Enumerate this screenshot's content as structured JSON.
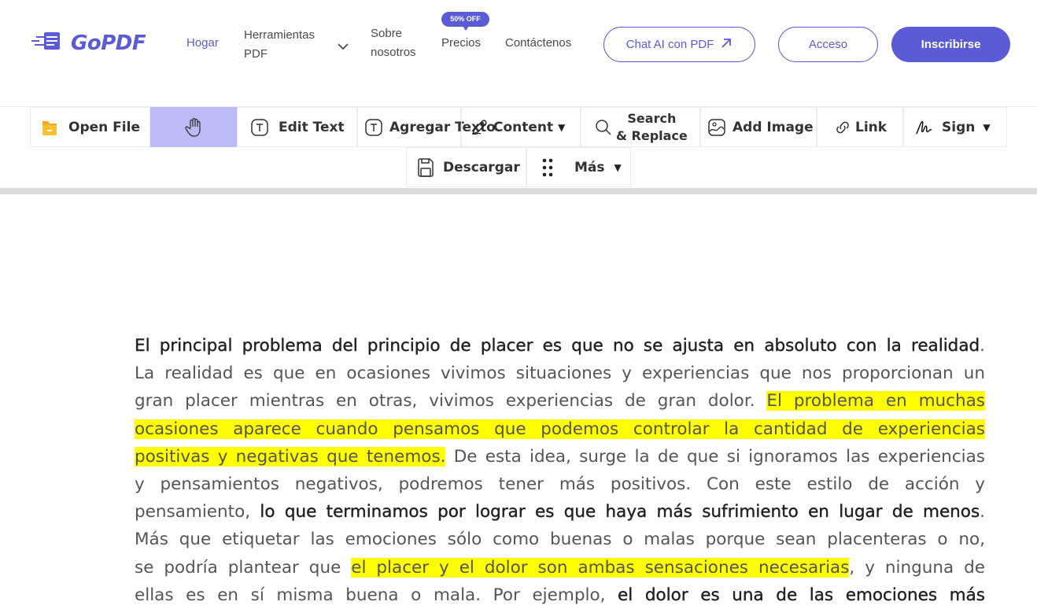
{
  "header": {
    "logo_text": "GoPDF",
    "nav": {
      "home": "Hogar",
      "tools_line1": "Herramientas",
      "tools_line2": "PDF",
      "about_line1": "Sobre",
      "about_line2": "nosotros",
      "prices": "Precios",
      "prices_badge": "50% OFF",
      "contact": "Contáctenos"
    },
    "chat_button": "Chat AI con PDF",
    "login_button": "Acceso",
    "signup_button": "Inscribirse",
    "colors": {
      "brand": "#5b5bd6"
    }
  },
  "toolbar": {
    "open_file": "Open File",
    "hand_tool_active": true,
    "edit_text": "Edit Text",
    "add_text": "Agregar Texto",
    "content": "Content",
    "search_line1": "Search",
    "search_line2": "& Replace",
    "add_image": "Add Image",
    "link": "Link",
    "sign": "Sign",
    "download": "Descargar",
    "more": "Más",
    "colors": {
      "active_tool_bg": "#bbbbf7"
    }
  },
  "document": {
    "highlight_color": "#ffff00",
    "lines": [
      [
        {
          "t": "El principal problema del principio de placer es que no se ajusta en absoluto con la realidad",
          "s": "b"
        },
        {
          "t": ".",
          "s": ""
        }
      ],
      [
        {
          "t": "La realidad es que en ocasiones vivimos situaciones y experiencias que nos proporcionan un",
          "s": ""
        }
      ],
      [
        {
          "t": "gran placer mientras en otras, vivimos experiencias de gran dolor. ",
          "s": ""
        },
        {
          "t": "El problema en muchas",
          "s": "hl"
        }
      ],
      [
        {
          "t": "ocasiones aparece cuando pensamos que podemos controlar la cantidad de experiencias",
          "s": "hl"
        }
      ],
      [
        {
          "t": "positivas y negativas que tenemos.",
          "s": "hl"
        },
        {
          "t": " De esta idea, surge la de que si ignoramos las experiencias",
          "s": ""
        }
      ],
      [
        {
          "t": "y pensamientos negativos, podremos tener más positivos. Con este estilo de acción y",
          "s": ""
        }
      ],
      [
        {
          "t": "pensamiento, ",
          "s": ""
        },
        {
          "t": "lo que terminamos por lograr es que haya más sufrimiento en lugar de menos",
          "s": "b"
        },
        {
          "t": ".",
          "s": ""
        }
      ],
      [
        {
          "t": "Más que etiquetar las emociones sólo como buenas o malas porque sean placenteras o no,",
          "s": ""
        }
      ],
      [
        {
          "t": "se podría plantear que ",
          "s": ""
        },
        {
          "t": "el placer y el dolor son ambas sensaciones necesarias",
          "s": "hl"
        },
        {
          "t": ", y ninguna de",
          "s": ""
        }
      ],
      [
        {
          "t": "ellas es en sí misma buena o mala. Por ejemplo, ",
          "s": ""
        },
        {
          "t": "el dolor es una de las emociones más",
          "s": "b"
        }
      ]
    ]
  }
}
